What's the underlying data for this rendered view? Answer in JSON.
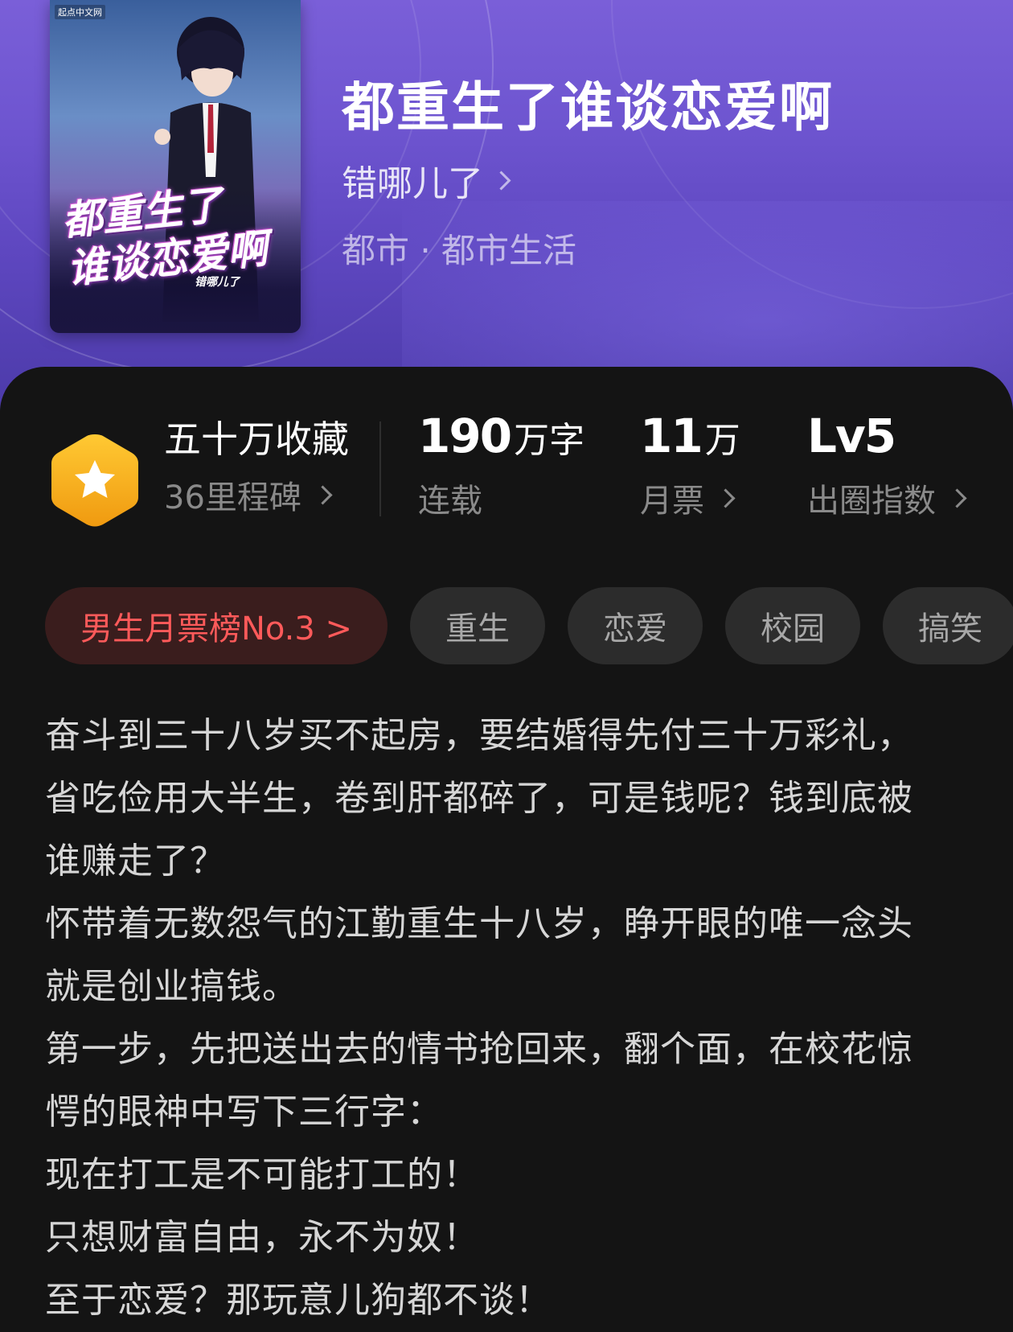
{
  "book": {
    "title": "都重生了谁谈恋爱啊",
    "author": "错哪儿了",
    "genre": "都市 · 都市生活"
  },
  "cover": {
    "publisher": "起点中文网",
    "title_line1": "都重生了",
    "title_line2": "谁谈恋爱啊",
    "author": "错哪儿了"
  },
  "stats": {
    "collection": {
      "title": "五十万收藏",
      "sub": "36里程碑"
    },
    "words": {
      "number": "190",
      "unit": "万字",
      "label": "连载"
    },
    "tickets": {
      "number": "11",
      "unit": "万",
      "label": "月票"
    },
    "index": {
      "number": "Lv5",
      "label": "出圈指数"
    }
  },
  "tags": {
    "rank": "男生月票榜No.3 >",
    "items": [
      "重生",
      "恋爱",
      "校园",
      "搞笑"
    ]
  },
  "synopsis": [
    "奋斗到三十八岁买不起房，要结婚得先付三十万彩礼，省吃俭用大半生，卷到肝都碎了，可是钱呢？钱到底被谁赚走了？",
    "怀带着无数怨气的江勤重生十八岁，睁开眼的唯一念头就是创业搞钱。",
    "第一步，先把送出去的情书抢回来，翻个面，在校花惊愕的眼神中写下三行字：",
    "现在打工是不可能打工的！",
    "只想财富自由，永不为奴！",
    "至于恋爱？那玩意儿狗都不谈！"
  ],
  "colors": {
    "header_top": "#7a5fd8",
    "header_bottom": "#4b3aa8",
    "card_bg": "#141414",
    "rank_text": "#ff5a5a",
    "rank_bg": "#3a1d1d",
    "tag_bg": "#2c2c2c",
    "badge": "#f6b21b"
  },
  "icons": {
    "badge": "star-hexagon-icon",
    "chevron": "chevron-right-icon"
  }
}
